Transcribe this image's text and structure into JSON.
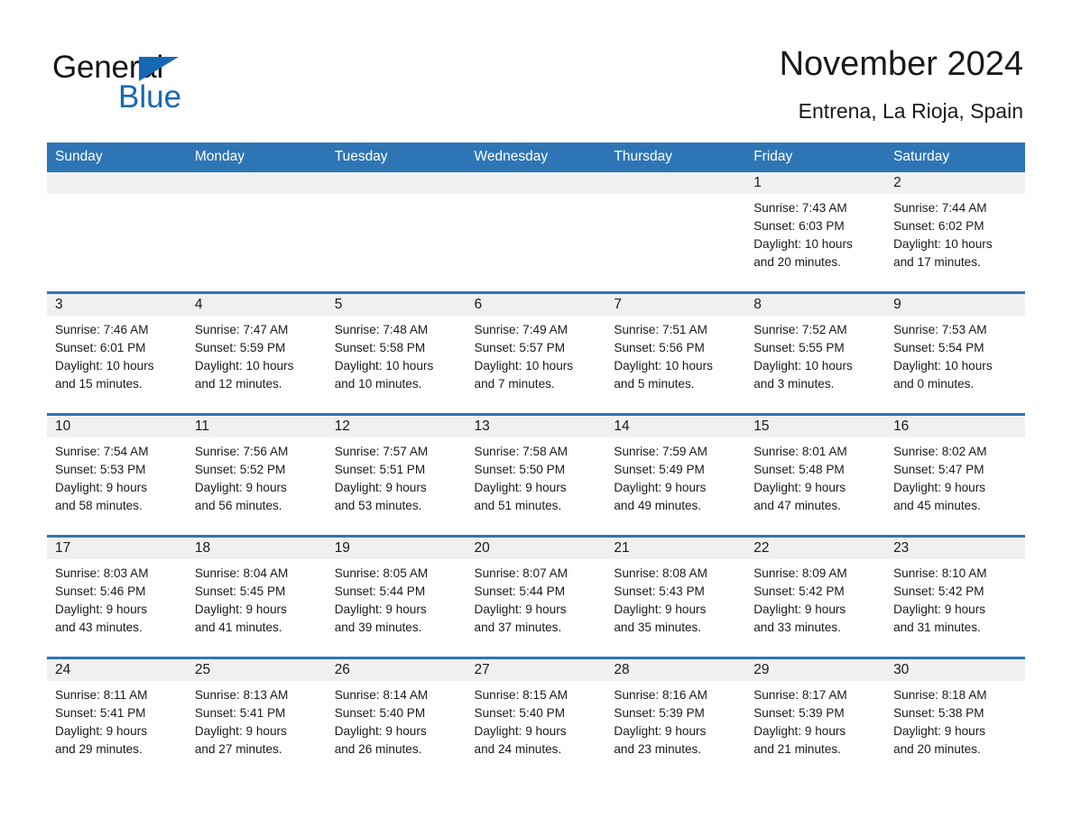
{
  "brand": {
    "word_black": "General",
    "word_blue": "Blue",
    "triangle_icon": "blue-triangle-icon",
    "accent_color": "#1668b3"
  },
  "header": {
    "title": "November 2024",
    "location": "Entrena, La Rioja, Spain"
  },
  "calendar": {
    "header_bg": "#2e75b5",
    "daynum_bg": "#f0f0f0",
    "weekday_headers": [
      "Sunday",
      "Monday",
      "Tuesday",
      "Wednesday",
      "Thursday",
      "Friday",
      "Saturday"
    ],
    "weeks": [
      [
        {
          "day": "",
          "sunrise": "",
          "sunset": "",
          "daylight_line1": "",
          "daylight_line2": "",
          "empty": true
        },
        {
          "day": "",
          "sunrise": "",
          "sunset": "",
          "daylight_line1": "",
          "daylight_line2": "",
          "empty": true
        },
        {
          "day": "",
          "sunrise": "",
          "sunset": "",
          "daylight_line1": "",
          "daylight_line2": "",
          "empty": true
        },
        {
          "day": "",
          "sunrise": "",
          "sunset": "",
          "daylight_line1": "",
          "daylight_line2": "",
          "empty": true
        },
        {
          "day": "",
          "sunrise": "",
          "sunset": "",
          "daylight_line1": "",
          "daylight_line2": "",
          "empty": true
        },
        {
          "day": "1",
          "sunrise": "Sunrise: 7:43 AM",
          "sunset": "Sunset: 6:03 PM",
          "daylight_line1": "Daylight: 10 hours",
          "daylight_line2": "and 20 minutes.",
          "empty": false
        },
        {
          "day": "2",
          "sunrise": "Sunrise: 7:44 AM",
          "sunset": "Sunset: 6:02 PM",
          "daylight_line1": "Daylight: 10 hours",
          "daylight_line2": "and 17 minutes.",
          "empty": false
        }
      ],
      [
        {
          "day": "3",
          "sunrise": "Sunrise: 7:46 AM",
          "sunset": "Sunset: 6:01 PM",
          "daylight_line1": "Daylight: 10 hours",
          "daylight_line2": "and 15 minutes.",
          "empty": false
        },
        {
          "day": "4",
          "sunrise": "Sunrise: 7:47 AM",
          "sunset": "Sunset: 5:59 PM",
          "daylight_line1": "Daylight: 10 hours",
          "daylight_line2": "and 12 minutes.",
          "empty": false
        },
        {
          "day": "5",
          "sunrise": "Sunrise: 7:48 AM",
          "sunset": "Sunset: 5:58 PM",
          "daylight_line1": "Daylight: 10 hours",
          "daylight_line2": "and 10 minutes.",
          "empty": false
        },
        {
          "day": "6",
          "sunrise": "Sunrise: 7:49 AM",
          "sunset": "Sunset: 5:57 PM",
          "daylight_line1": "Daylight: 10 hours",
          "daylight_line2": "and 7 minutes.",
          "empty": false
        },
        {
          "day": "7",
          "sunrise": "Sunrise: 7:51 AM",
          "sunset": "Sunset: 5:56 PM",
          "daylight_line1": "Daylight: 10 hours",
          "daylight_line2": "and 5 minutes.",
          "empty": false
        },
        {
          "day": "8",
          "sunrise": "Sunrise: 7:52 AM",
          "sunset": "Sunset: 5:55 PM",
          "daylight_line1": "Daylight: 10 hours",
          "daylight_line2": "and 3 minutes.",
          "empty": false
        },
        {
          "day": "9",
          "sunrise": "Sunrise: 7:53 AM",
          "sunset": "Sunset: 5:54 PM",
          "daylight_line1": "Daylight: 10 hours",
          "daylight_line2": "and 0 minutes.",
          "empty": false
        }
      ],
      [
        {
          "day": "10",
          "sunrise": "Sunrise: 7:54 AM",
          "sunset": "Sunset: 5:53 PM",
          "daylight_line1": "Daylight: 9 hours",
          "daylight_line2": "and 58 minutes.",
          "empty": false
        },
        {
          "day": "11",
          "sunrise": "Sunrise: 7:56 AM",
          "sunset": "Sunset: 5:52 PM",
          "daylight_line1": "Daylight: 9 hours",
          "daylight_line2": "and 56 minutes.",
          "empty": false
        },
        {
          "day": "12",
          "sunrise": "Sunrise: 7:57 AM",
          "sunset": "Sunset: 5:51 PM",
          "daylight_line1": "Daylight: 9 hours",
          "daylight_line2": "and 53 minutes.",
          "empty": false
        },
        {
          "day": "13",
          "sunrise": "Sunrise: 7:58 AM",
          "sunset": "Sunset: 5:50 PM",
          "daylight_line1": "Daylight: 9 hours",
          "daylight_line2": "and 51 minutes.",
          "empty": false
        },
        {
          "day": "14",
          "sunrise": "Sunrise: 7:59 AM",
          "sunset": "Sunset: 5:49 PM",
          "daylight_line1": "Daylight: 9 hours",
          "daylight_line2": "and 49 minutes.",
          "empty": false
        },
        {
          "day": "15",
          "sunrise": "Sunrise: 8:01 AM",
          "sunset": "Sunset: 5:48 PM",
          "daylight_line1": "Daylight: 9 hours",
          "daylight_line2": "and 47 minutes.",
          "empty": false
        },
        {
          "day": "16",
          "sunrise": "Sunrise: 8:02 AM",
          "sunset": "Sunset: 5:47 PM",
          "daylight_line1": "Daylight: 9 hours",
          "daylight_line2": "and 45 minutes.",
          "empty": false
        }
      ],
      [
        {
          "day": "17",
          "sunrise": "Sunrise: 8:03 AM",
          "sunset": "Sunset: 5:46 PM",
          "daylight_line1": "Daylight: 9 hours",
          "daylight_line2": "and 43 minutes.",
          "empty": false
        },
        {
          "day": "18",
          "sunrise": "Sunrise: 8:04 AM",
          "sunset": "Sunset: 5:45 PM",
          "daylight_line1": "Daylight: 9 hours",
          "daylight_line2": "and 41 minutes.",
          "empty": false
        },
        {
          "day": "19",
          "sunrise": "Sunrise: 8:05 AM",
          "sunset": "Sunset: 5:44 PM",
          "daylight_line1": "Daylight: 9 hours",
          "daylight_line2": "and 39 minutes.",
          "empty": false
        },
        {
          "day": "20",
          "sunrise": "Sunrise: 8:07 AM",
          "sunset": "Sunset: 5:44 PM",
          "daylight_line1": "Daylight: 9 hours",
          "daylight_line2": "and 37 minutes.",
          "empty": false
        },
        {
          "day": "21",
          "sunrise": "Sunrise: 8:08 AM",
          "sunset": "Sunset: 5:43 PM",
          "daylight_line1": "Daylight: 9 hours",
          "daylight_line2": "and 35 minutes.",
          "empty": false
        },
        {
          "day": "22",
          "sunrise": "Sunrise: 8:09 AM",
          "sunset": "Sunset: 5:42 PM",
          "daylight_line1": "Daylight: 9 hours",
          "daylight_line2": "and 33 minutes.",
          "empty": false
        },
        {
          "day": "23",
          "sunrise": "Sunrise: 8:10 AM",
          "sunset": "Sunset: 5:42 PM",
          "daylight_line1": "Daylight: 9 hours",
          "daylight_line2": "and 31 minutes.",
          "empty": false
        }
      ],
      [
        {
          "day": "24",
          "sunrise": "Sunrise: 8:11 AM",
          "sunset": "Sunset: 5:41 PM",
          "daylight_line1": "Daylight: 9 hours",
          "daylight_line2": "and 29 minutes.",
          "empty": false
        },
        {
          "day": "25",
          "sunrise": "Sunrise: 8:13 AM",
          "sunset": "Sunset: 5:41 PM",
          "daylight_line1": "Daylight: 9 hours",
          "daylight_line2": "and 27 minutes.",
          "empty": false
        },
        {
          "day": "26",
          "sunrise": "Sunrise: 8:14 AM",
          "sunset": "Sunset: 5:40 PM",
          "daylight_line1": "Daylight: 9 hours",
          "daylight_line2": "and 26 minutes.",
          "empty": false
        },
        {
          "day": "27",
          "sunrise": "Sunrise: 8:15 AM",
          "sunset": "Sunset: 5:40 PM",
          "daylight_line1": "Daylight: 9 hours",
          "daylight_line2": "and 24 minutes.",
          "empty": false
        },
        {
          "day": "28",
          "sunrise": "Sunrise: 8:16 AM",
          "sunset": "Sunset: 5:39 PM",
          "daylight_line1": "Daylight: 9 hours",
          "daylight_line2": "and 23 minutes.",
          "empty": false
        },
        {
          "day": "29",
          "sunrise": "Sunrise: 8:17 AM",
          "sunset": "Sunset: 5:39 PM",
          "daylight_line1": "Daylight: 9 hours",
          "daylight_line2": "and 21 minutes.",
          "empty": false
        },
        {
          "day": "30",
          "sunrise": "Sunrise: 8:18 AM",
          "sunset": "Sunset: 5:38 PM",
          "daylight_line1": "Daylight: 9 hours",
          "daylight_line2": "and 20 minutes.",
          "empty": false
        }
      ]
    ]
  }
}
